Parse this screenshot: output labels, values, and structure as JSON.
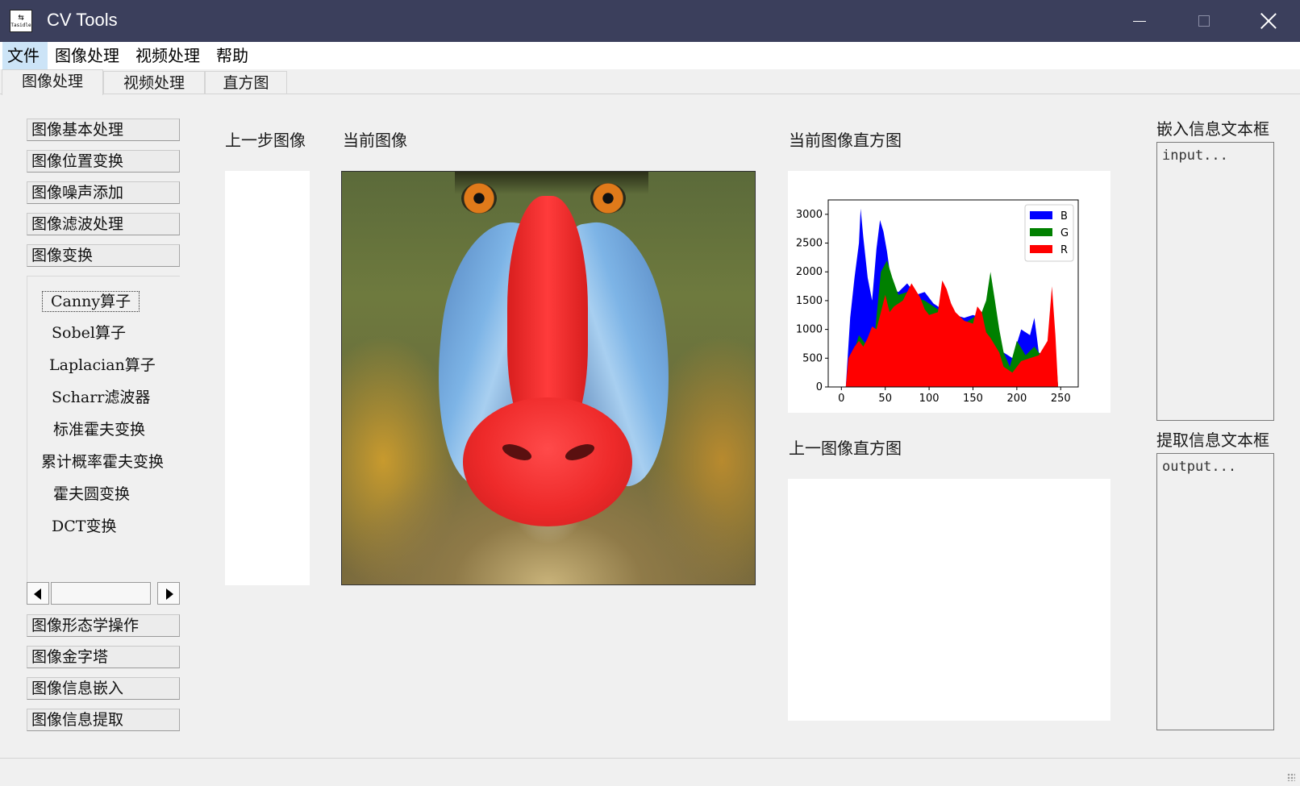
{
  "window": {
    "title": "CV Tools",
    "icon_text": "Tasidle"
  },
  "menu": [
    "文件",
    "图像处理",
    "视频处理",
    "帮助"
  ],
  "tabs": [
    "图像处理",
    "视频处理",
    "直方图"
  ],
  "left_panel": {
    "top_buttons": [
      "图像基本处理",
      "图像位置变换",
      "图像噪声添加",
      "图像滤波处理",
      "图像变换"
    ],
    "sub_items": [
      "Canny算子",
      "Sobel算子",
      "Laplacian算子",
      "Scharr滤波器",
      "标准霍夫变换",
      "累计概率霍夫变换",
      "霍夫圆变换",
      "DCT变换"
    ],
    "bottom_buttons": [
      "图像形态学操作",
      "图像金字塔",
      "图像信息嵌入",
      "图像信息提取"
    ]
  },
  "labels": {
    "previous_image": "上一步图像",
    "current_image": "当前图像",
    "current_hist": "当前图像直方图",
    "previous_hist": "上一图像直方图",
    "embed_box": "嵌入信息文本框",
    "extract_box": "提取信息文本框"
  },
  "textboxes": {
    "embed_placeholder": "input...",
    "extract_placeholder": "output..."
  },
  "chart_data": {
    "type": "area",
    "x_ticks": [
      0,
      50,
      100,
      150,
      200,
      250
    ],
    "y_ticks": [
      0,
      500,
      1000,
      1500,
      2000,
      2500,
      3000
    ],
    "xlim": [
      -15,
      270
    ],
    "ylim": [
      0,
      3250
    ],
    "legend_position": "top-right",
    "series": [
      {
        "name": "B",
        "color": "#0000ff",
        "points": [
          [
            5,
            0
          ],
          [
            10,
            1200
          ],
          [
            15,
            1900
          ],
          [
            20,
            2500
          ],
          [
            22,
            3100
          ],
          [
            25,
            2600
          ],
          [
            30,
            1900
          ],
          [
            35,
            1500
          ],
          [
            40,
            2400
          ],
          [
            44,
            2900
          ],
          [
            48,
            2700
          ],
          [
            52,
            2350
          ],
          [
            58,
            1700
          ],
          [
            65,
            1650
          ],
          [
            75,
            1800
          ],
          [
            85,
            1600
          ],
          [
            95,
            1650
          ],
          [
            105,
            1450
          ],
          [
            115,
            1350
          ],
          [
            120,
            1650
          ],
          [
            130,
            1250
          ],
          [
            140,
            1200
          ],
          [
            150,
            1250
          ],
          [
            160,
            1200
          ],
          [
            168,
            1300
          ],
          [
            175,
            1050
          ],
          [
            185,
            600
          ],
          [
            195,
            500
          ],
          [
            205,
            1000
          ],
          [
            215,
            900
          ],
          [
            220,
            1200
          ],
          [
            225,
            600
          ],
          [
            235,
            500
          ],
          [
            240,
            800
          ],
          [
            244,
            600
          ],
          [
            247,
            0
          ]
        ]
      },
      {
        "name": "G",
        "color": "#008000",
        "points": [
          [
            5,
            0
          ],
          [
            10,
            400
          ],
          [
            20,
            900
          ],
          [
            30,
            700
          ],
          [
            38,
            900
          ],
          [
            45,
            2000
          ],
          [
            52,
            2200
          ],
          [
            58,
            1900
          ],
          [
            65,
            1600
          ],
          [
            75,
            1650
          ],
          [
            85,
            1550
          ],
          [
            95,
            1500
          ],
          [
            105,
            1400
          ],
          [
            115,
            1300
          ],
          [
            120,
            1600
          ],
          [
            130,
            1150
          ],
          [
            140,
            1100
          ],
          [
            150,
            1200
          ],
          [
            160,
            1300
          ],
          [
            165,
            1500
          ],
          [
            170,
            2000
          ],
          [
            175,
            1500
          ],
          [
            180,
            1000
          ],
          [
            185,
            600
          ],
          [
            192,
            350
          ],
          [
            200,
            800
          ],
          [
            210,
            550
          ],
          [
            220,
            700
          ],
          [
            230,
            500
          ],
          [
            240,
            900
          ],
          [
            244,
            700
          ],
          [
            247,
            0
          ]
        ]
      },
      {
        "name": "R",
        "color": "#ff0000",
        "points": [
          [
            5,
            0
          ],
          [
            8,
            500
          ],
          [
            15,
            700
          ],
          [
            20,
            800
          ],
          [
            25,
            700
          ],
          [
            30,
            850
          ],
          [
            35,
            1050
          ],
          [
            40,
            1000
          ],
          [
            45,
            1300
          ],
          [
            50,
            1600
          ],
          [
            55,
            1300
          ],
          [
            60,
            1400
          ],
          [
            70,
            1500
          ],
          [
            80,
            1800
          ],
          [
            90,
            1550
          ],
          [
            95,
            1350
          ],
          [
            100,
            1250
          ],
          [
            110,
            1300
          ],
          [
            115,
            1850
          ],
          [
            120,
            1700
          ],
          [
            125,
            1450
          ],
          [
            130,
            1300
          ],
          [
            140,
            1150
          ],
          [
            150,
            1100
          ],
          [
            155,
            1400
          ],
          [
            160,
            1300
          ],
          [
            165,
            950
          ],
          [
            170,
            850
          ],
          [
            180,
            600
          ],
          [
            185,
            350
          ],
          [
            195,
            250
          ],
          [
            205,
            450
          ],
          [
            215,
            500
          ],
          [
            225,
            550
          ],
          [
            235,
            800
          ],
          [
            240,
            1750
          ],
          [
            244,
            900
          ],
          [
            247,
            0
          ]
        ]
      }
    ]
  }
}
